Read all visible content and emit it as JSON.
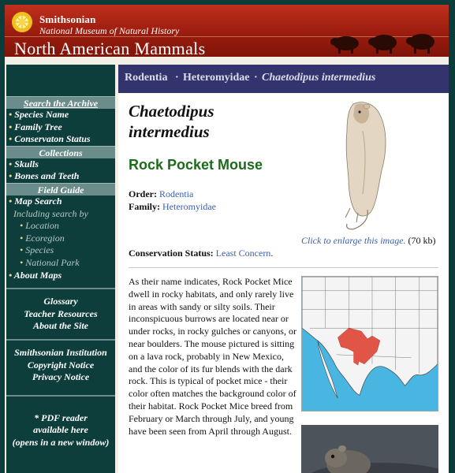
{
  "banner": {
    "institution": "Smithsonian",
    "museum": "National Museum of Natural History",
    "site_title": "North American Mammals",
    "sun_icon": "sun-logo-icon",
    "musk_icon": "musk-ox-silhouettes"
  },
  "sidebar": {
    "archive_heading": "Search the Archive",
    "archive_items": [
      "Species Name",
      "Family Tree",
      "Conservaton Status"
    ],
    "collections_heading": "Collections",
    "collections_items": [
      "Skulls",
      "Bones and Teeth"
    ],
    "field_heading": "Field Guide",
    "map_search": "Map Search",
    "including": "Including search by",
    "search_by": [
      "Location",
      "Ecoregion",
      "Species",
      "National Park"
    ],
    "about_maps": "About Maps",
    "block2": [
      "Glossary",
      "Teacher Resources",
      "About the Site"
    ],
    "block3": [
      "Smithsonian Institution",
      "Copyright Notice",
      "Privacy Notice"
    ],
    "pdf": [
      "* PDF reader",
      "available here",
      "(opens in a new window)"
    ],
    "bullet": "•"
  },
  "breadcrumb": {
    "order": "Rodentia",
    "sep1": "·",
    "family": "Heteromyidae",
    "sep2": "·",
    "species": "Chaetodipus intermedius"
  },
  "species": {
    "sci_name_line1": "Chaetodipus",
    "sci_name_line2": "intermedius",
    "common_name": "Rock Pocket Mouse",
    "order_label": "Order:",
    "order_value": "Rodentia",
    "family_label": "Family:",
    "family_value": "Heteromyidae",
    "enlarge_link": "Click to enlarge this image.",
    "enlarge_size": "(70 kb)",
    "conservation_label": "Conservation Status:",
    "conservation_value": "Least Concern",
    "conservation_end": ".",
    "description": "As their name indicates, Rock Pocket Mice dwell in rocky habitats, and only rarely live in areas with sandy or silty soils. Their inconspicuous burrows are located near or under rocks, in rocky gulches or canyons, or near boulders. The mouse pictured is sitting on a lava rock, probably in New Mexico, and the color of its fur blends with the dark rock. This is typical of pocket mice - their color often matches the background color of their habitat. Rock Pocket Mice breed from February or March through July, and young have been seen from April through August."
  },
  "colors": {
    "sidebar_bg": "#0d3e3c",
    "banner_red": "#9e1e10",
    "crumb_bg": "#33346e",
    "common_green": "#1b6b1b",
    "link_blue": "#3a5fb0",
    "range_red": "#e05545",
    "map_ocean": "#48b6e0"
  }
}
